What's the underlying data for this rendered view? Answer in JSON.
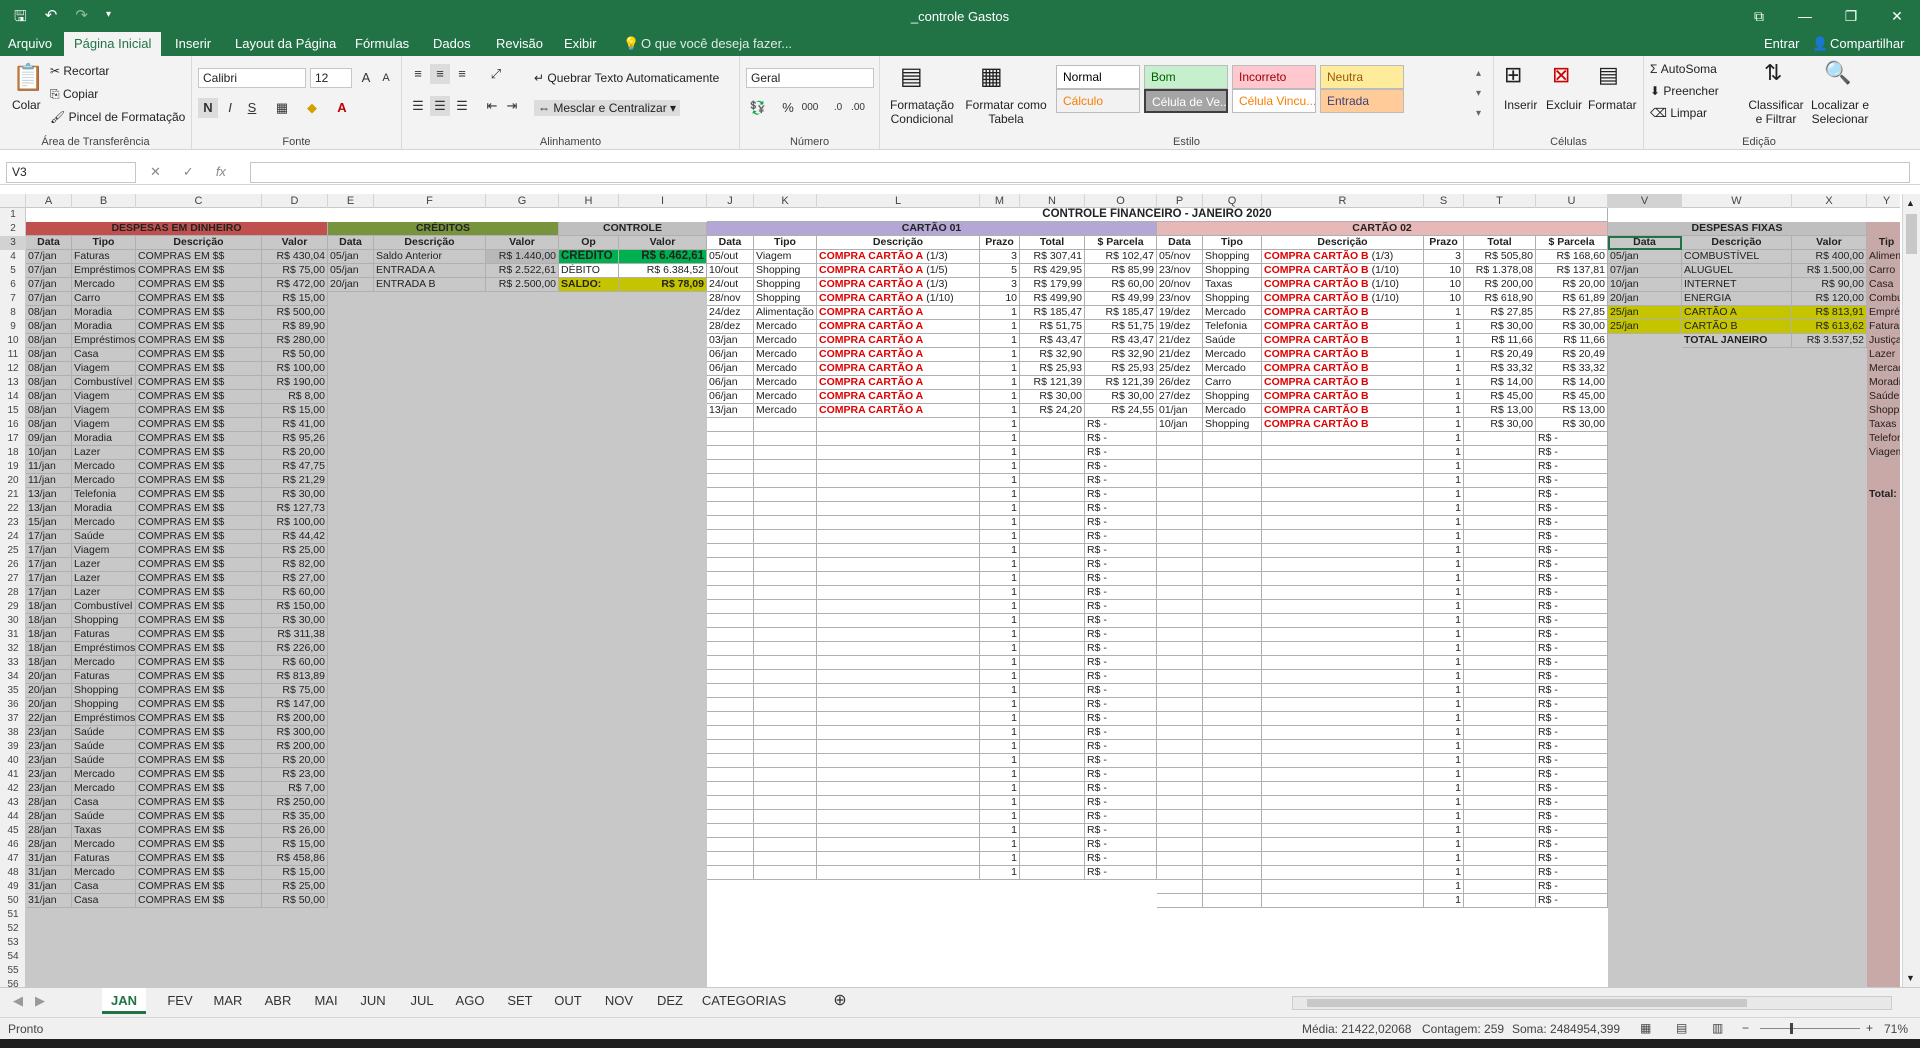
{
  "window": {
    "title": "_controle Gastos",
    "minimize": "—",
    "maximize": "❐",
    "close": "✕",
    "restore": "⧉"
  },
  "menu": {
    "tabs": [
      "Arquivo",
      "Página Inicial",
      "Inserir",
      "Layout da Página",
      "Fórmulas",
      "Dados",
      "Revisão",
      "Exibir"
    ],
    "active": 1,
    "tell_me": "O que você deseja fazer...",
    "signin": "Entrar",
    "share": "Compartilhar"
  },
  "ribbon": {
    "clipboard": {
      "paste": "Colar",
      "cut": "Recortar",
      "copy": "Copiar",
      "painter": "Pincel de Formatação",
      "label": "Área de Transferência"
    },
    "font": {
      "name": "Calibri",
      "size": "12",
      "bold": "N",
      "italic": "I",
      "underline": "S",
      "label": "Fonte"
    },
    "alignment": {
      "wrap": "Quebrar Texto Automaticamente",
      "merge": "Mesclar e Centralizar",
      "label": "Alinhamento"
    },
    "number": {
      "format": "Geral",
      "label": "Número"
    },
    "styles": {
      "cond": "Formatação Condicional",
      "table": "Formatar como Tabela",
      "label": "Estilo",
      "cells": [
        {
          "text": "Normal",
          "bg": "#ffffff",
          "fg": "#000000"
        },
        {
          "text": "Bom",
          "bg": "#c6efce",
          "fg": "#006100"
        },
        {
          "text": "Incorreto",
          "bg": "#ffc7ce",
          "fg": "#9c0006"
        },
        {
          "text": "Neutra",
          "bg": "#ffeb9c",
          "fg": "#9c5700"
        },
        {
          "text": "Cálculo",
          "bg": "#f2f2f2",
          "fg": "#fa7d00"
        },
        {
          "text": "Célula de Ve...",
          "bg": "#a5a5a5",
          "fg": "#ffffff"
        },
        {
          "text": "Célula Vincu...",
          "bg": "#ffffff",
          "fg": "#fa7d00"
        },
        {
          "text": "Entrada",
          "bg": "#ffcc99",
          "fg": "#3f3f76"
        }
      ]
    },
    "cells": {
      "insert": "Inserir",
      "delete": "Excluir",
      "format": "Formatar",
      "label": "Células"
    },
    "editing": {
      "autosum": "AutoSoma",
      "fill": "Preencher",
      "clear": "Limpar",
      "sort": "Classificar e Filtrar",
      "find": "Localizar e Selecionar",
      "label": "Edição"
    }
  },
  "formula": {
    "namebox": "V3",
    "fx": "fx"
  },
  "columns": [
    "A",
    "B",
    "C",
    "D",
    "E",
    "F",
    "G",
    "H",
    "I",
    "J",
    "K",
    "L",
    "M",
    "N",
    "O",
    "P",
    "Q",
    "R",
    "S",
    "T",
    "U",
    "V",
    "W",
    "X",
    "Y"
  ],
  "sheet": {
    "title": "CONTROLE FINANCEIRO - JANEIRO 2020",
    "sec": {
      "dinheiro": "DESPESAS EM DINHEIRO",
      "creditos": "CRÉDITOS",
      "controle": "CONTROLE",
      "cartao1": "CARTÃO 01",
      "cartao2": "CARTÃO 02",
      "fixas": "DESPESAS FIXAS"
    },
    "hdrs": {
      "data": "Data",
      "tipo": "Tipo",
      "desc": "Descrição",
      "valor": "Valor",
      "op": "Op",
      "prazo": "Prazo",
      "total": "Total",
      "parcela": "$ Parcela",
      "tipo_y": "Tip"
    },
    "dinheiro": [
      [
        "07/jan",
        "Faturas",
        "COMPRAS EM $$",
        "R$ 430,04"
      ],
      [
        "07/jan",
        "Empréstimos",
        "COMPRAS EM $$",
        "R$ 75,00"
      ],
      [
        "07/jan",
        "Mercado",
        "COMPRAS EM $$",
        "R$ 472,00"
      ],
      [
        "07/jan",
        "Carro",
        "COMPRAS EM $$",
        "R$ 15,00"
      ],
      [
        "08/jan",
        "Moradia",
        "COMPRAS EM $$",
        "R$ 500,00"
      ],
      [
        "08/jan",
        "Moradia",
        "COMPRAS EM $$",
        "R$ 89,90"
      ],
      [
        "08/jan",
        "Empréstimos",
        "COMPRAS EM $$",
        "R$ 280,00"
      ],
      [
        "08/jan",
        "Casa",
        "COMPRAS EM $$",
        "R$ 50,00"
      ],
      [
        "08/jan",
        "Viagem",
        "COMPRAS EM $$",
        "R$ 100,00"
      ],
      [
        "08/jan",
        "Combustível",
        "COMPRAS EM $$",
        "R$ 190,00"
      ],
      [
        "08/jan",
        "Viagem",
        "COMPRAS EM $$",
        "R$ 8,00"
      ],
      [
        "08/jan",
        "Viagem",
        "COMPRAS EM $$",
        "R$ 15,00"
      ],
      [
        "08/jan",
        "Viagem",
        "COMPRAS EM $$",
        "R$ 41,00"
      ],
      [
        "09/jan",
        "Moradia",
        "COMPRAS EM $$",
        "R$ 95,26"
      ],
      [
        "10/jan",
        "Lazer",
        "COMPRAS EM $$",
        "R$ 20,00"
      ],
      [
        "11/jan",
        "Mercado",
        "COMPRAS EM $$",
        "R$ 47,75"
      ],
      [
        "11/jan",
        "Mercado",
        "COMPRAS EM $$",
        "R$ 21,29"
      ],
      [
        "13/jan",
        "Telefonia",
        "COMPRAS EM $$",
        "R$ 30,00"
      ],
      [
        "13/jan",
        "Moradia",
        "COMPRAS EM $$",
        "R$ 127,73"
      ],
      [
        "15/jan",
        "Mercado",
        "COMPRAS EM $$",
        "R$ 100,00"
      ],
      [
        "17/jan",
        "Saúde",
        "COMPRAS EM $$",
        "R$ 44,42"
      ],
      [
        "17/jan",
        "Viagem",
        "COMPRAS EM $$",
        "R$ 25,00"
      ],
      [
        "17/jan",
        "Lazer",
        "COMPRAS EM $$",
        "R$ 82,00"
      ],
      [
        "17/jan",
        "Lazer",
        "COMPRAS EM $$",
        "R$ 27,00"
      ],
      [
        "17/jan",
        "Lazer",
        "COMPRAS EM $$",
        "R$ 60,00"
      ],
      [
        "18/jan",
        "Combustível",
        "COMPRAS EM $$",
        "R$ 150,00"
      ],
      [
        "18/jan",
        "Shopping",
        "COMPRAS EM $$",
        "R$ 30,00"
      ],
      [
        "18/jan",
        "Faturas",
        "COMPRAS EM $$",
        "R$ 311,38"
      ],
      [
        "18/jan",
        "Empréstimos",
        "COMPRAS EM $$",
        "R$ 226,00"
      ],
      [
        "18/jan",
        "Mercado",
        "COMPRAS EM $$",
        "R$ 60,00"
      ],
      [
        "20/jan",
        "Faturas",
        "COMPRAS EM $$",
        "R$ 813,89"
      ],
      [
        "20/jan",
        "Shopping",
        "COMPRAS EM $$",
        "R$ 75,00"
      ],
      [
        "20/jan",
        "Shopping",
        "COMPRAS EM $$",
        "R$ 147,00"
      ],
      [
        "22/jan",
        "Empréstimos",
        "COMPRAS EM $$",
        "R$ 200,00"
      ],
      [
        "23/jan",
        "Saúde",
        "COMPRAS EM $$",
        "R$ 300,00"
      ],
      [
        "23/jan",
        "Saúde",
        "COMPRAS EM $$",
        "R$ 200,00"
      ],
      [
        "23/jan",
        "Saúde",
        "COMPRAS EM $$",
        "R$ 20,00"
      ],
      [
        "23/jan",
        "Mercado",
        "COMPRAS EM $$",
        "R$ 23,00"
      ],
      [
        "23/jan",
        "Mercado",
        "COMPRAS EM $$",
        "R$ 7,00"
      ],
      [
        "28/jan",
        "Casa",
        "COMPRAS EM $$",
        "R$ 250,00"
      ],
      [
        "28/jan",
        "Saúde",
        "COMPRAS EM $$",
        "R$ 35,00"
      ],
      [
        "28/jan",
        "Taxas",
        "COMPRAS EM $$",
        "R$ 26,00"
      ],
      [
        "28/jan",
        "Mercado",
        "COMPRAS EM $$",
        "R$ 15,00"
      ],
      [
        "31/jan",
        "Faturas",
        "COMPRAS EM $$",
        "R$ 458,86"
      ],
      [
        "31/jan",
        "Mercado",
        "COMPRAS EM $$",
        "R$ 15,00"
      ],
      [
        "31/jan",
        "Casa",
        "COMPRAS EM $$",
        "R$ 25,00"
      ],
      [
        "31/jan",
        "Casa",
        "COMPRAS EM $$",
        "R$ 50,00"
      ]
    ],
    "creditos": [
      [
        "05/jan",
        "Saldo Anterior",
        "R$ 1.440,00"
      ],
      [
        "05/jan",
        "ENTRADA A",
        "R$ 2.522,61"
      ],
      [
        "20/jan",
        "ENTRADA B",
        "R$ 2.500,00"
      ]
    ],
    "controle": [
      [
        "CRÉDITO",
        "R$ 6.462,61"
      ],
      [
        "DÉBITO",
        "R$ 6.384,52"
      ],
      [
        "SALDO:",
        "R$ 78,09"
      ]
    ],
    "cartao1": [
      [
        "05/out",
        "Viagem",
        "COMPRA CARTÃO A",
        "(1/3)",
        "3",
        "R$ 307,41",
        "R$ 102,47"
      ],
      [
        "10/out",
        "Shopping",
        "COMPRA CARTÃO A",
        "(1/5)",
        "5",
        "R$ 429,95",
        "R$ 85,99"
      ],
      [
        "24/out",
        "Shopping",
        "COMPRA CARTÃO A",
        "(1/3)",
        "3",
        "R$ 179,99",
        "R$ 60,00"
      ],
      [
        "28/nov",
        "Shopping",
        "COMPRA CARTÃO A",
        "(1/10)",
        "10",
        "R$ 499,90",
        "R$ 49,99"
      ],
      [
        "24/dez",
        "Alimentação",
        "COMPRA CARTÃO A",
        "",
        "1",
        "R$ 185,47",
        "R$ 185,47"
      ],
      [
        "28/dez",
        "Mercado",
        "COMPRA CARTÃO A",
        "",
        "1",
        "R$ 51,75",
        "R$ 51,75"
      ],
      [
        "03/jan",
        "Mercado",
        "COMPRA CARTÃO A",
        "",
        "1",
        "R$ 43,47",
        "R$ 43,47"
      ],
      [
        "06/jan",
        "Mercado",
        "COMPRA CARTÃO A",
        "",
        "1",
        "R$ 32,90",
        "R$ 32,90"
      ],
      [
        "06/jan",
        "Mercado",
        "COMPRA CARTÃO A",
        "",
        "1",
        "R$ 25,93",
        "R$ 25,93"
      ],
      [
        "06/jan",
        "Mercado",
        "COMPRA CARTÃO A",
        "",
        "1",
        "R$ 121,39",
        "R$ 121,39"
      ],
      [
        "06/jan",
        "Mercado",
        "COMPRA CARTÃO A",
        "",
        "1",
        "R$ 30,00",
        "R$ 30,00"
      ],
      [
        "13/jan",
        "Mercado",
        "COMPRA CARTÃO A",
        "",
        "1",
        "R$ 24,20",
        "R$ 24,55"
      ]
    ],
    "cartao2": [
      [
        "05/nov",
        "Shopping",
        "COMPRA CARTÃO B",
        "(1/3)",
        "3",
        "R$ 505,80",
        "R$ 168,60"
      ],
      [
        "23/nov",
        "Shopping",
        "COMPRA CARTÃO B",
        "(1/10)",
        "10",
        "R$ 1.378,08",
        "R$ 137,81"
      ],
      [
        "20/nov",
        "Taxas",
        "COMPRA CARTÃO B",
        "(1/10)",
        "10",
        "R$ 200,00",
        "R$ 20,00"
      ],
      [
        "23/nov",
        "Shopping",
        "COMPRA CARTÃO B",
        "(1/10)",
        "10",
        "R$ 618,90",
        "R$ 61,89"
      ],
      [
        "19/dez",
        "Mercado",
        "COMPRA CARTÃO B",
        "",
        "1",
        "R$ 27,85",
        "R$ 27,85"
      ],
      [
        "19/dez",
        "Telefonia",
        "COMPRA CARTÃO B",
        "",
        "1",
        "R$ 30,00",
        "R$ 30,00"
      ],
      [
        "21/dez",
        "Saúde",
        "COMPRA CARTÃO B",
        "",
        "1",
        "R$ 11,66",
        "R$ 11,66"
      ],
      [
        "21/dez",
        "Mercado",
        "COMPRA CARTÃO B",
        "",
        "1",
        "R$ 20,49",
        "R$ 20,49"
      ],
      [
        "25/dez",
        "Mercado",
        "COMPRA CARTÃO B",
        "",
        "1",
        "R$ 33,32",
        "R$ 33,32"
      ],
      [
        "26/dez",
        "Carro",
        "COMPRA CARTÃO B",
        "",
        "1",
        "R$ 14,00",
        "R$ 14,00"
      ],
      [
        "27/dez",
        "Shopping",
        "COMPRA CARTÃO B",
        "",
        "1",
        "R$ 45,00",
        "R$ 45,00"
      ],
      [
        "01/jan",
        "Mercado",
        "COMPRA CARTÃO B",
        "",
        "1",
        "R$ 13,00",
        "R$ 13,00"
      ],
      [
        "10/jan",
        "Shopping",
        "COMPRA CARTÃO B",
        "",
        "1",
        "R$ 30,00",
        "R$ 30,00"
      ]
    ],
    "fixas": [
      [
        "05/jan",
        "COMBUSTÍVEL",
        "R$ 400,00"
      ],
      [
        "07/jan",
        "ALUGUEL",
        "R$ 1.500,00"
      ],
      [
        "10/jan",
        "INTERNET",
        "R$ 90,00"
      ],
      [
        "20/jan",
        "ENERGIA",
        "R$ 120,00"
      ],
      [
        "25/jan",
        "CARTÃO A",
        "R$ 813,91"
      ],
      [
        "25/jan",
        "CARTÃO B",
        "R$ 613,62"
      ]
    ],
    "fixas_total": [
      "TOTAL JANEIRO",
      "R$ 3.537,52"
    ],
    "tipos": [
      "Alimen",
      "Carro",
      "Casa",
      "Combu",
      "Emprés",
      "Faturas",
      "Justiça",
      "Lazer",
      "Mercad",
      "Moradi",
      "Saúde",
      "Shoppi",
      "Taxas",
      "Telefon",
      "Viagem"
    ],
    "tipos_total": "Total:",
    "empty_parcela": "R$ -",
    "empty_prazo": "1",
    "c1_empty_rows": 33,
    "c2_empty_rows": 34,
    "last_row": 56
  },
  "sheets": [
    "JAN",
    "FEV",
    "MAR",
    "ABR",
    "MAI",
    "JUN",
    "JUL",
    "AGO",
    "SET",
    "OUT",
    "NOV",
    "DEZ",
    "CATEGORIAS"
  ],
  "sheets_active": 0,
  "status": {
    "ready": "Pronto",
    "media": "Média: 21422,02068",
    "contagem": "Contagem: 259",
    "soma": "Soma: 2484954,399",
    "zoom": "71%"
  },
  "colors": {
    "brand": "#217346",
    "dinheiro": "#c0504d",
    "creditos": "#77933c",
    "controle": "#bfbfbf",
    "cartao1": "#b4a7d6",
    "cartao2": "#e6b8b7",
    "fixas": "#bfbfbf",
    "gray": "#c8c8c8",
    "highlight": "#c4c400",
    "credit_green": "#00b050",
    "saldo": "#c4c400",
    "pink": "#c9a9a8"
  }
}
